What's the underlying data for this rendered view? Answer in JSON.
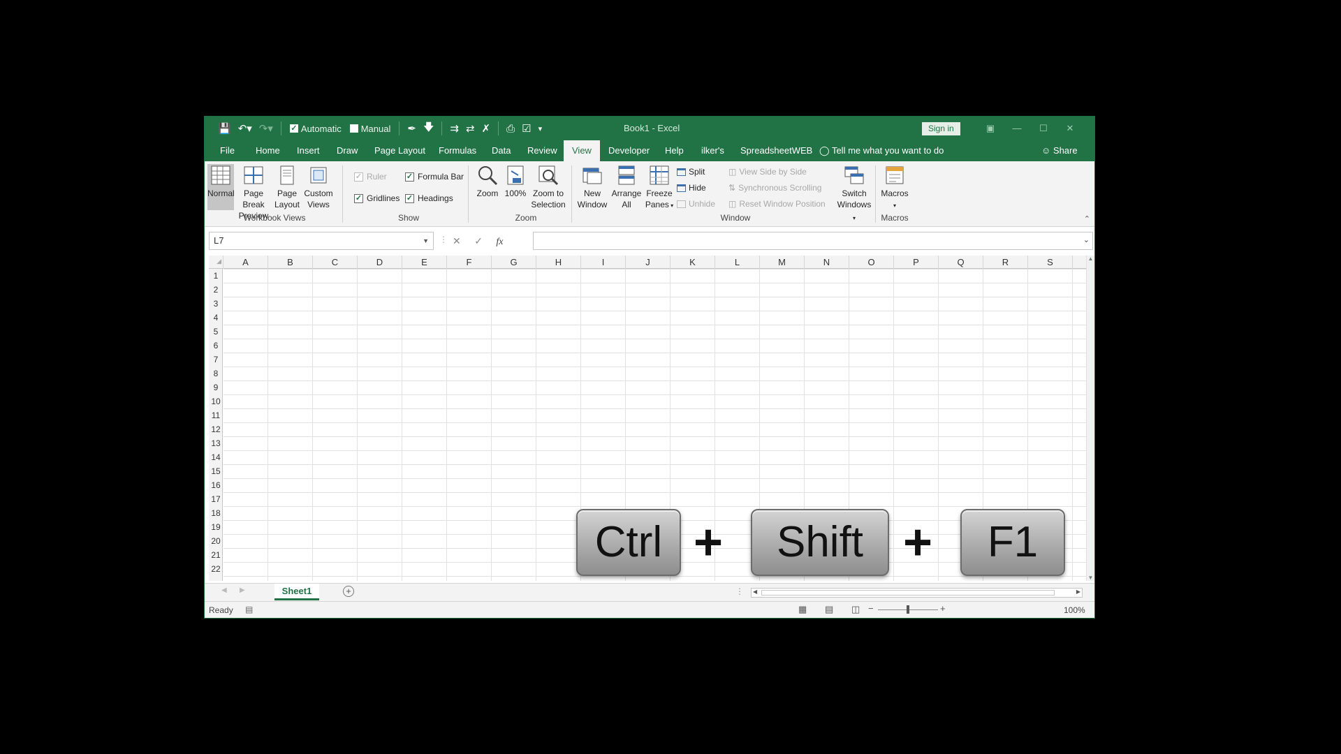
{
  "qat": {
    "automatic_label": "Automatic",
    "manual_label": "Manual"
  },
  "title": "Book1  -  Excel",
  "signin_label": "Sign in",
  "tabs": [
    "File",
    "Home",
    "Insert",
    "Draw",
    "Page Layout",
    "Formulas",
    "Data",
    "Review",
    "View",
    "Developer",
    "Help",
    "ilker's",
    "SpreadsheetWEB"
  ],
  "active_tab": "View",
  "tell_me": "Tell me what you want to do",
  "share_label": "Share",
  "ribbon": {
    "workbook_views": {
      "label": "Workbook Views",
      "normal": "Normal",
      "page_break_1": "Page Break",
      "page_break_2": "Preview",
      "page_layout_1": "Page",
      "page_layout_2": "Layout",
      "custom_views_1": "Custom",
      "custom_views_2": "Views"
    },
    "show": {
      "label": "Show",
      "ruler": "Ruler",
      "formula_bar": "Formula Bar",
      "gridlines": "Gridlines",
      "headings": "Headings"
    },
    "zoom": {
      "label": "Zoom",
      "zoom": "Zoom",
      "hundred": "100%",
      "zoom_sel_1": "Zoom to",
      "zoom_sel_2": "Selection"
    },
    "window": {
      "label": "Window",
      "new_window_1": "New",
      "new_window_2": "Window",
      "arrange_1": "Arrange",
      "arrange_2": "All",
      "freeze_1": "Freeze",
      "freeze_2": "Panes",
      "split": "Split",
      "hide": "Hide",
      "unhide": "Unhide",
      "side_by_side": "View Side by Side",
      "sync_scroll": "Synchronous Scrolling",
      "reset_pos": "Reset Window Position",
      "switch_1": "Switch",
      "switch_2": "Windows"
    },
    "macros": {
      "label": "Macros",
      "macros": "Macros"
    }
  },
  "name_box": "L7",
  "fx_label": "fx",
  "columns": [
    "A",
    "B",
    "C",
    "D",
    "E",
    "F",
    "G",
    "H",
    "I",
    "J",
    "K",
    "L",
    "M",
    "N",
    "O",
    "P",
    "Q",
    "R",
    "S"
  ],
  "rows": [
    "1",
    "2",
    "3",
    "4",
    "5",
    "6",
    "7",
    "8",
    "9",
    "10",
    "11",
    "12",
    "13",
    "14",
    "15",
    "16",
    "17",
    "18",
    "19",
    "20",
    "21",
    "22"
  ],
  "keys": {
    "k1": "Ctrl",
    "k2": "Shift",
    "k3": "F1",
    "plus": "+"
  },
  "sheet_tab": "Sheet1",
  "status": {
    "ready": "Ready",
    "zoom": "100%"
  },
  "colors": {
    "excel_green": "#217346",
    "ribbon_bg": "#f3f3f3"
  }
}
